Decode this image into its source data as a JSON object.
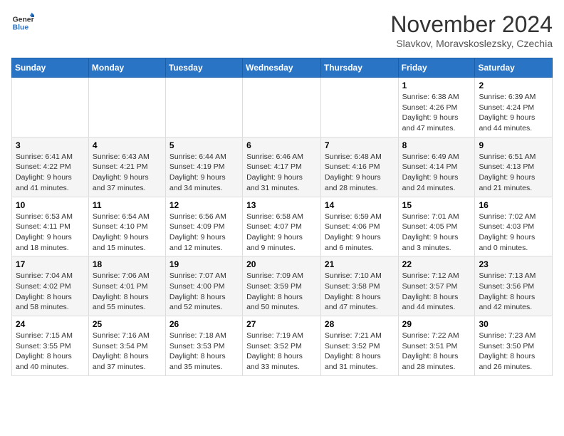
{
  "header": {
    "logo_line1": "General",
    "logo_line2": "Blue",
    "month": "November 2024",
    "location": "Slavkov, Moravskoslezsky, Czechia"
  },
  "columns": [
    "Sunday",
    "Monday",
    "Tuesday",
    "Wednesday",
    "Thursday",
    "Friday",
    "Saturday"
  ],
  "weeks": [
    [
      {
        "day": "",
        "info": ""
      },
      {
        "day": "",
        "info": ""
      },
      {
        "day": "",
        "info": ""
      },
      {
        "day": "",
        "info": ""
      },
      {
        "day": "",
        "info": ""
      },
      {
        "day": "1",
        "info": "Sunrise: 6:38 AM\nSunset: 4:26 PM\nDaylight: 9 hours and 47 minutes."
      },
      {
        "day": "2",
        "info": "Sunrise: 6:39 AM\nSunset: 4:24 PM\nDaylight: 9 hours and 44 minutes."
      }
    ],
    [
      {
        "day": "3",
        "info": "Sunrise: 6:41 AM\nSunset: 4:22 PM\nDaylight: 9 hours and 41 minutes."
      },
      {
        "day": "4",
        "info": "Sunrise: 6:43 AM\nSunset: 4:21 PM\nDaylight: 9 hours and 37 minutes."
      },
      {
        "day": "5",
        "info": "Sunrise: 6:44 AM\nSunset: 4:19 PM\nDaylight: 9 hours and 34 minutes."
      },
      {
        "day": "6",
        "info": "Sunrise: 6:46 AM\nSunset: 4:17 PM\nDaylight: 9 hours and 31 minutes."
      },
      {
        "day": "7",
        "info": "Sunrise: 6:48 AM\nSunset: 4:16 PM\nDaylight: 9 hours and 28 minutes."
      },
      {
        "day": "8",
        "info": "Sunrise: 6:49 AM\nSunset: 4:14 PM\nDaylight: 9 hours and 24 minutes."
      },
      {
        "day": "9",
        "info": "Sunrise: 6:51 AM\nSunset: 4:13 PM\nDaylight: 9 hours and 21 minutes."
      }
    ],
    [
      {
        "day": "10",
        "info": "Sunrise: 6:53 AM\nSunset: 4:11 PM\nDaylight: 9 hours and 18 minutes."
      },
      {
        "day": "11",
        "info": "Sunrise: 6:54 AM\nSunset: 4:10 PM\nDaylight: 9 hours and 15 minutes."
      },
      {
        "day": "12",
        "info": "Sunrise: 6:56 AM\nSunset: 4:09 PM\nDaylight: 9 hours and 12 minutes."
      },
      {
        "day": "13",
        "info": "Sunrise: 6:58 AM\nSunset: 4:07 PM\nDaylight: 9 hours and 9 minutes."
      },
      {
        "day": "14",
        "info": "Sunrise: 6:59 AM\nSunset: 4:06 PM\nDaylight: 9 hours and 6 minutes."
      },
      {
        "day": "15",
        "info": "Sunrise: 7:01 AM\nSunset: 4:05 PM\nDaylight: 9 hours and 3 minutes."
      },
      {
        "day": "16",
        "info": "Sunrise: 7:02 AM\nSunset: 4:03 PM\nDaylight: 9 hours and 0 minutes."
      }
    ],
    [
      {
        "day": "17",
        "info": "Sunrise: 7:04 AM\nSunset: 4:02 PM\nDaylight: 8 hours and 58 minutes."
      },
      {
        "day": "18",
        "info": "Sunrise: 7:06 AM\nSunset: 4:01 PM\nDaylight: 8 hours and 55 minutes."
      },
      {
        "day": "19",
        "info": "Sunrise: 7:07 AM\nSunset: 4:00 PM\nDaylight: 8 hours and 52 minutes."
      },
      {
        "day": "20",
        "info": "Sunrise: 7:09 AM\nSunset: 3:59 PM\nDaylight: 8 hours and 50 minutes."
      },
      {
        "day": "21",
        "info": "Sunrise: 7:10 AM\nSunset: 3:58 PM\nDaylight: 8 hours and 47 minutes."
      },
      {
        "day": "22",
        "info": "Sunrise: 7:12 AM\nSunset: 3:57 PM\nDaylight: 8 hours and 44 minutes."
      },
      {
        "day": "23",
        "info": "Sunrise: 7:13 AM\nSunset: 3:56 PM\nDaylight: 8 hours and 42 minutes."
      }
    ],
    [
      {
        "day": "24",
        "info": "Sunrise: 7:15 AM\nSunset: 3:55 PM\nDaylight: 8 hours and 40 minutes."
      },
      {
        "day": "25",
        "info": "Sunrise: 7:16 AM\nSunset: 3:54 PM\nDaylight: 8 hours and 37 minutes."
      },
      {
        "day": "26",
        "info": "Sunrise: 7:18 AM\nSunset: 3:53 PM\nDaylight: 8 hours and 35 minutes."
      },
      {
        "day": "27",
        "info": "Sunrise: 7:19 AM\nSunset: 3:52 PM\nDaylight: 8 hours and 33 minutes."
      },
      {
        "day": "28",
        "info": "Sunrise: 7:21 AM\nSunset: 3:52 PM\nDaylight: 8 hours and 31 minutes."
      },
      {
        "day": "29",
        "info": "Sunrise: 7:22 AM\nSunset: 3:51 PM\nDaylight: 8 hours and 28 minutes."
      },
      {
        "day": "30",
        "info": "Sunrise: 7:23 AM\nSunset: 3:50 PM\nDaylight: 8 hours and 26 minutes."
      }
    ]
  ]
}
